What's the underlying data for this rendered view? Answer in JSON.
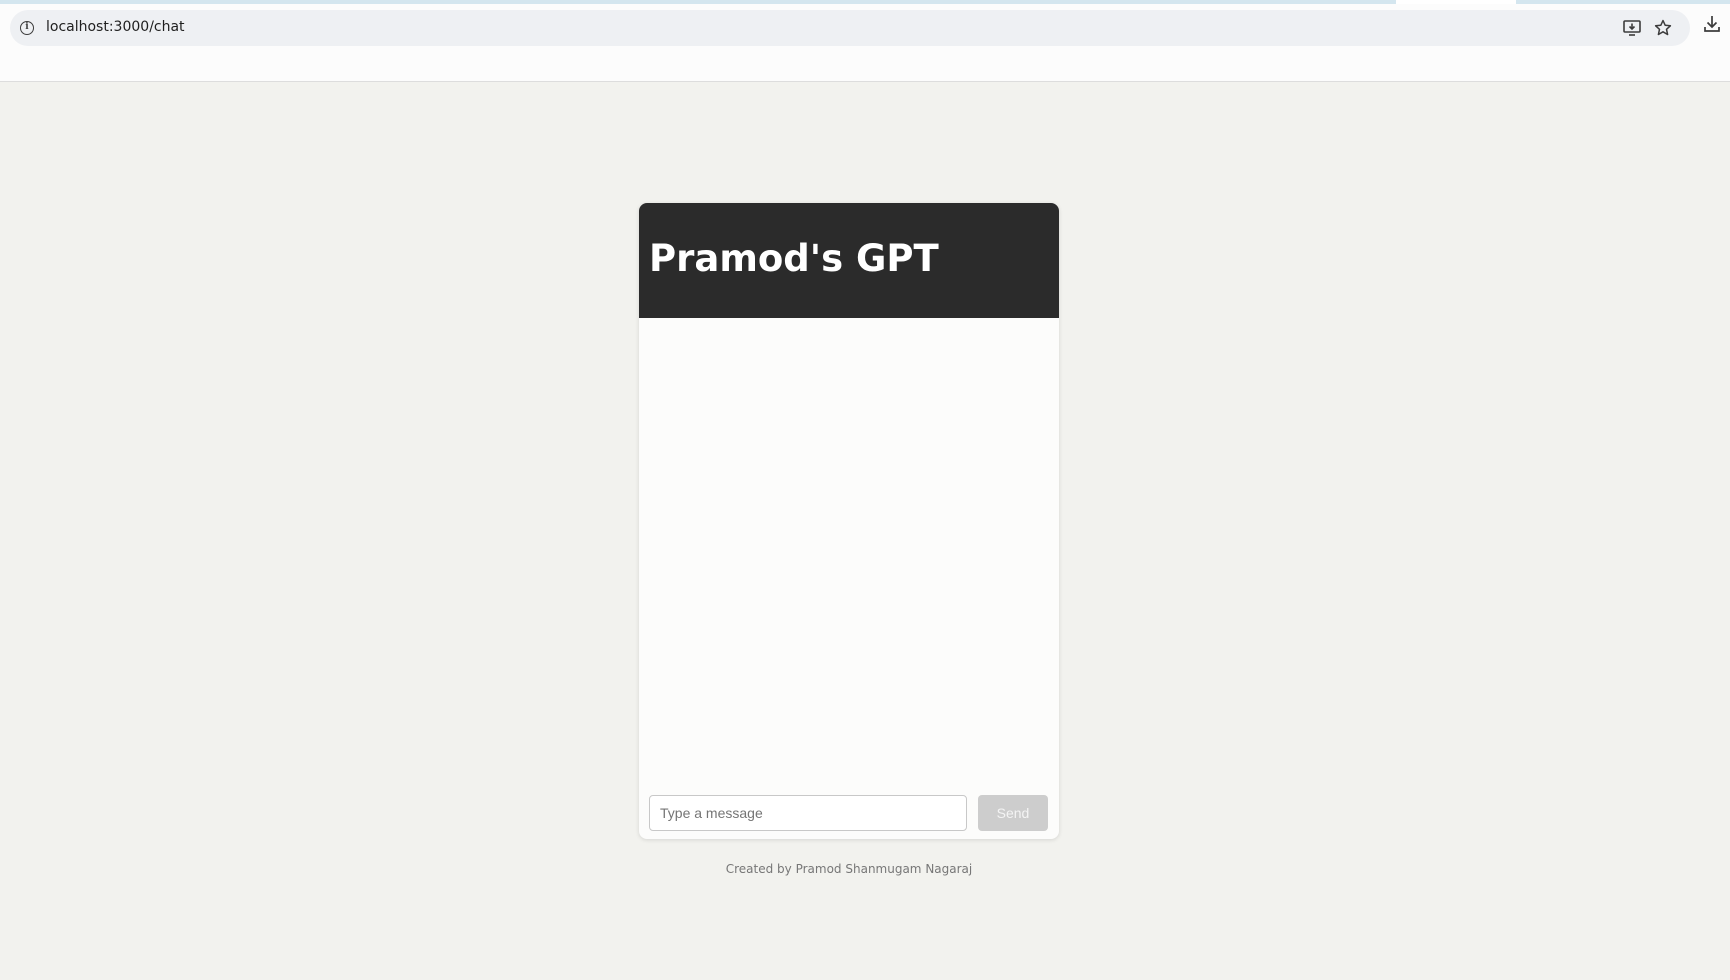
{
  "browser": {
    "url": "localhost:3000/chat",
    "icons": {
      "site_info": "info-icon",
      "install": "install-app-icon",
      "bookmark": "star-icon",
      "download": "download-icon"
    }
  },
  "chat": {
    "title": "Pramod's GPT",
    "messages": [],
    "input_placeholder": "Type a message",
    "input_value": "",
    "send_label": "Send",
    "send_enabled": false
  },
  "footer": {
    "credit": "Created by Pramod Shanmugam Nagaraj"
  },
  "colors": {
    "page_background": "#f2f2ee",
    "header_background": "#2b2b2b",
    "card_background": "#fcfcfb",
    "send_disabled": "#cdcdcd"
  }
}
